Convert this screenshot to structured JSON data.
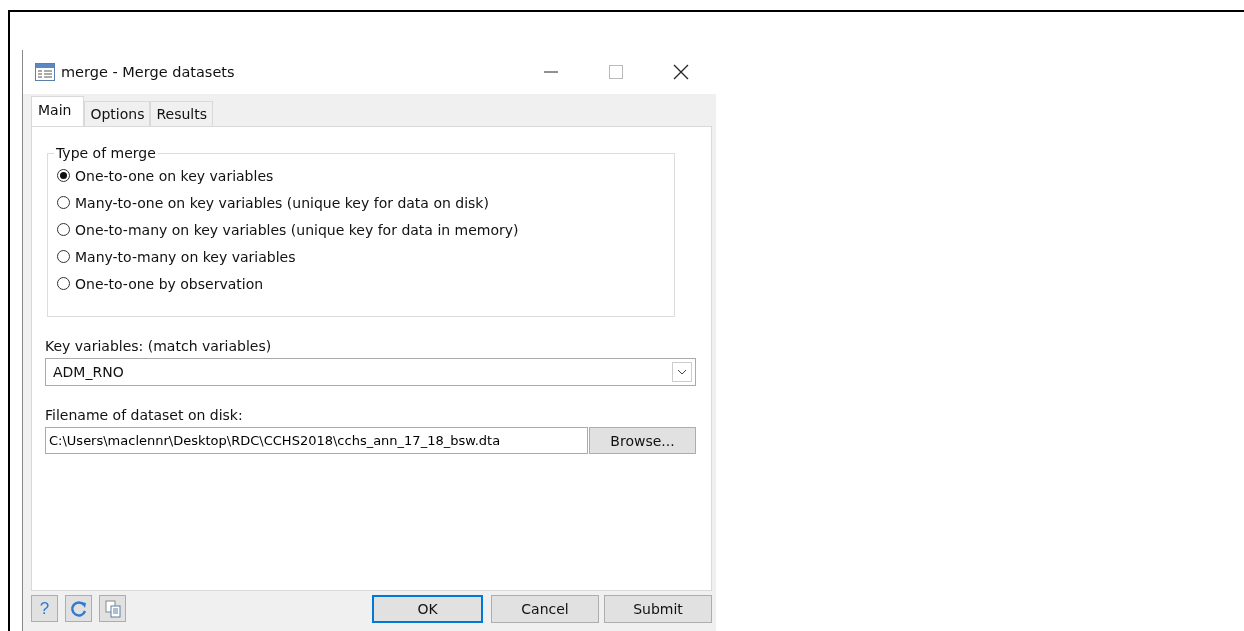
{
  "window": {
    "title": "merge - Merge datasets"
  },
  "tabs": [
    {
      "label": "Main",
      "selected": true
    },
    {
      "label": "Options",
      "selected": false
    },
    {
      "label": "Results",
      "selected": false
    }
  ],
  "merge_type": {
    "title": "Type of merge",
    "options": [
      {
        "label": "One-to-one on key variables",
        "selected": true
      },
      {
        "label": "Many-to-one on key variables (unique key for data on disk)",
        "selected": false
      },
      {
        "label": "One-to-many on key variables (unique key for data in memory)",
        "selected": false
      },
      {
        "label": "Many-to-many on key variables",
        "selected": false
      },
      {
        "label": "One-to-one by observation",
        "selected": false
      }
    ]
  },
  "key_variables": {
    "label": "Key variables: (match variables)",
    "value": "ADM_RNO"
  },
  "filename": {
    "label": "Filename of dataset on disk:",
    "value": "C:\\Users\\maclennr\\Desktop\\RDC\\CCHS2018\\cchs_ann_17_18_bsw.dta",
    "button": "Browse..."
  },
  "footer": {
    "help": "?",
    "buttons": [
      {
        "label": "OK",
        "default": true
      },
      {
        "label": "Cancel",
        "default": false
      },
      {
        "label": "Submit",
        "default": false
      }
    ]
  }
}
